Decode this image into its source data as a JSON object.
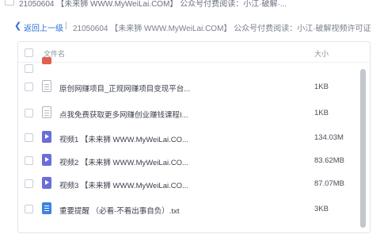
{
  "top_strip": {
    "text": "21050604 【未来狮 WWW.MyWeiLai.COM】 公众号付费阅读：小江·破解·..."
  },
  "path_bar": {
    "back_label": "返回上一级",
    "separator": "|",
    "current_path": "21050604 【未来狮 WWW.MyWeiLai.COM】 公众号付费阅读：小江·破解视频许可证"
  },
  "file_list": {
    "header": {
      "name_label": "文件名",
      "size_label": "大小"
    },
    "rows": [
      {
        "name": "",
        "size": "",
        "icon": "red-file-icon"
      },
      {
        "name": "原创网赚项目_正规网赚项目变现平台...",
        "size": "1KB",
        "icon": "document-icon"
      },
      {
        "name": "点我免费获取更多网赚创业赚钱课程I...",
        "size": "1KB",
        "icon": "document-icon"
      },
      {
        "name": "视频1 【未来狮 WWW.MyWeiLai.CO...",
        "size": "134.03M",
        "icon": "video-icon"
      },
      {
        "name": "视频2 【未来狮 WWW.MyWeiLai.CO...",
        "size": "83.62MB",
        "icon": "video-icon"
      },
      {
        "name": "视频3 【未来狮 WWW.MyWeiLai.CO...",
        "size": "87.07MB",
        "icon": "video-icon"
      },
      {
        "name": "重要提醒 （必看-不看出事自负）.txt",
        "size": "3KB",
        "icon": "text-file-icon"
      }
    ]
  },
  "colors": {
    "accent": "#2d6fd6",
    "video_icon": "#6a6fd8",
    "text_icon": "#3b83e0",
    "scrollbar": "#c2c6cd"
  }
}
